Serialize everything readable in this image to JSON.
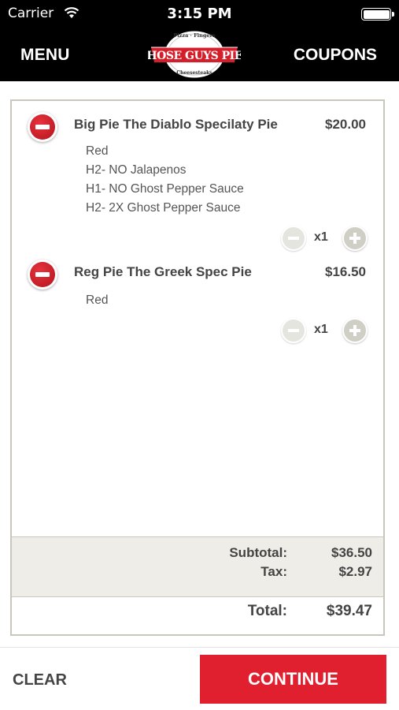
{
  "status_bar": {
    "carrier": "Carrier",
    "time": "3:15 PM"
  },
  "nav": {
    "menu_label": "MENU",
    "coupons_label": "COUPONS",
    "logo": {
      "main_text": "THOSE GUYS PIES",
      "top_text": "Pizza · Fingers",
      "bottom_text": "Cheesesteaks"
    }
  },
  "cart": {
    "items": [
      {
        "name": "Big Pie  The Diablo  Specilaty Pie",
        "price": "$20.00",
        "modifiers": [
          "Red",
          "H2- NO Jalapenos",
          "H1- NO Ghost Pepper Sauce",
          "H2- 2X Ghost Pepper Sauce"
        ],
        "quantity": "x1"
      },
      {
        "name": "Reg Pie  The Greek Spec Pie",
        "price": "$16.50",
        "modifiers": [
          "Red"
        ],
        "quantity": "x1"
      }
    ],
    "subtotal_label": "Subtotal:",
    "subtotal_value": "$36.50",
    "tax_label": "Tax:",
    "tax_value": "$2.97",
    "total_label": "Total:",
    "total_value": "$39.47"
  },
  "footer": {
    "clear_label": "CLEAR",
    "continue_label": "CONTINUE"
  },
  "colors": {
    "accent_red": "#e0202f",
    "nav_bg": "#000000",
    "totals_bg": "#eeede7"
  },
  "icons": [
    "wifi-icon",
    "battery-icon",
    "remove-item-icon",
    "quantity-minus-icon",
    "quantity-plus-icon"
  ]
}
